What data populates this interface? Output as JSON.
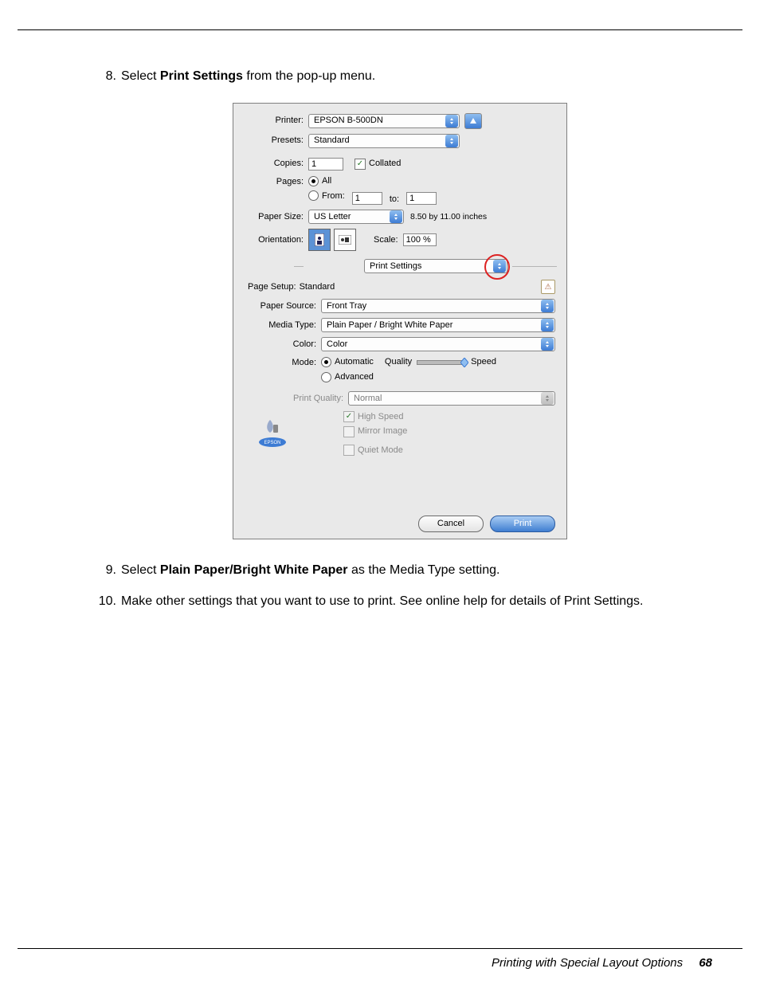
{
  "steps": {
    "s8": {
      "num": "8.",
      "prefix": "Select ",
      "bold": "Print Settings",
      "suffix": " from the pop-up menu."
    },
    "s9": {
      "num": "9.",
      "prefix": "Select ",
      "bold": "Plain Paper/Bright White Paper",
      "suffix": " as the Media Type setting."
    },
    "s10": {
      "num": "10.",
      "text": "Make other settings that you want to use to print. See online help for details of Print Settings."
    }
  },
  "dlg": {
    "printer_label": "Printer:",
    "printer_value": "EPSON B-500DN",
    "presets_label": "Presets:",
    "presets_value": "Standard",
    "copies_label": "Copies:",
    "copies_value": "1",
    "collated_label": "Collated",
    "pages_label": "Pages:",
    "pages_all": "All",
    "pages_from": "From:",
    "pages_from_value": "1",
    "pages_to": "to:",
    "pages_to_value": "1",
    "paper_size_label": "Paper Size:",
    "paper_size_value": "US Letter",
    "paper_size_dim": "8.50 by 11.00 inches",
    "orientation_label": "Orientation:",
    "scale_label": "Scale:",
    "scale_value": "100 %",
    "section_menu_value": "Print Settings",
    "page_setup_label": "Page Setup:",
    "page_setup_value": "Standard",
    "paper_source_label": "Paper Source:",
    "paper_source_value": "Front Tray",
    "media_type_label": "Media Type:",
    "media_type_value": "Plain Paper / Bright White Paper",
    "color_label": "Color:",
    "color_value": "Color",
    "mode_label": "Mode:",
    "mode_auto": "Automatic",
    "mode_adv": "Advanced",
    "quality_label": "Quality",
    "speed_label": "Speed",
    "print_quality_label": "Print Quality:",
    "print_quality_value": "Normal",
    "high_speed_label": "High Speed",
    "mirror_label": "Mirror Image",
    "quiet_label": "Quiet Mode",
    "cancel": "Cancel",
    "print": "Print"
  },
  "footer": {
    "title": "Printing with Special Layout Options",
    "page": "68"
  }
}
